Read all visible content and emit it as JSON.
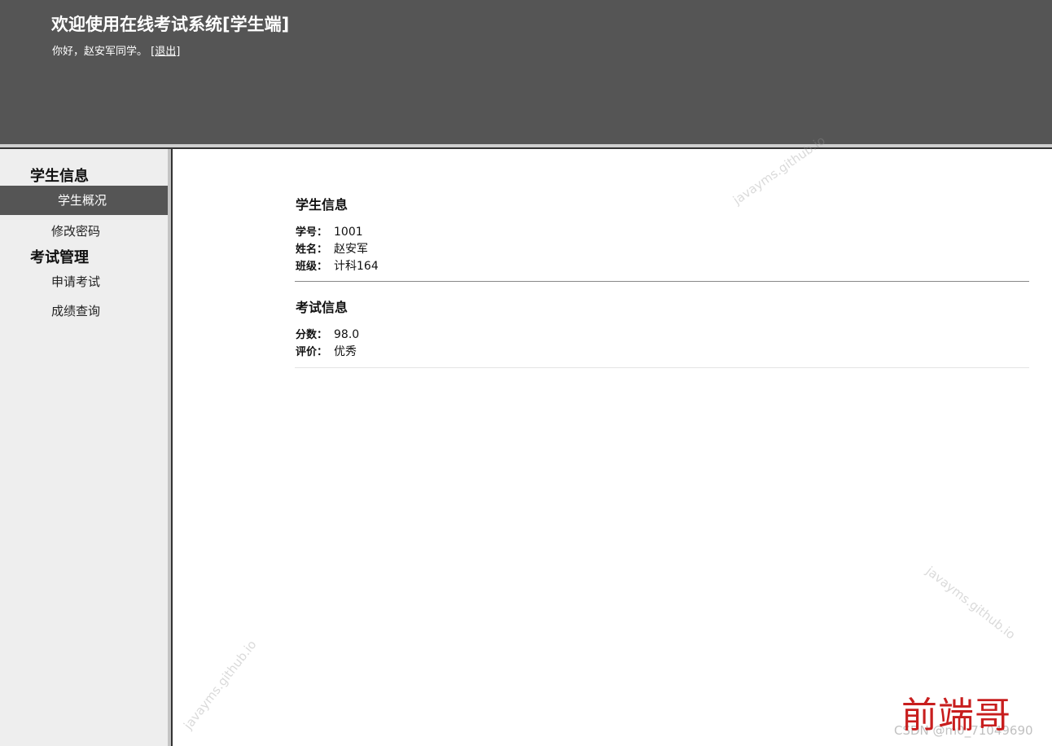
{
  "header": {
    "title": "欢迎使用在线考试系统[学生端]",
    "greeting_prefix": "你好，赵安军同学。 [",
    "logout_label": "退出",
    "greeting_suffix": "]"
  },
  "sidebar": {
    "sections": [
      {
        "title": "学生信息",
        "items": [
          {
            "label": "学生概况",
            "active": true
          },
          {
            "label": "修改密码",
            "active": false
          }
        ]
      },
      {
        "title": "考试管理",
        "items": [
          {
            "label": "申请考试",
            "active": false
          },
          {
            "label": "成绩查询",
            "active": false
          }
        ]
      }
    ]
  },
  "main": {
    "student_info": {
      "title": "学生信息",
      "rows": [
        {
          "label": "学号：",
          "value": "1001"
        },
        {
          "label": "姓名：",
          "value": "赵安军"
        },
        {
          "label": "班级：",
          "value": "计科164"
        }
      ]
    },
    "exam_info": {
      "title": "考试信息",
      "rows": [
        {
          "label": "分数：",
          "value": "98.0"
        },
        {
          "label": "评价：",
          "value": "优秀"
        }
      ]
    }
  },
  "watermarks": {
    "site": "javayms.github.io",
    "csdn": "CSDN @m0_71049690",
    "brand": "前端哥"
  },
  "colors": {
    "header_bg": "#555555",
    "sidebar_bg": "#eeeeee",
    "active_item_bg": "#555555",
    "brand_red": "#c81e1e"
  }
}
